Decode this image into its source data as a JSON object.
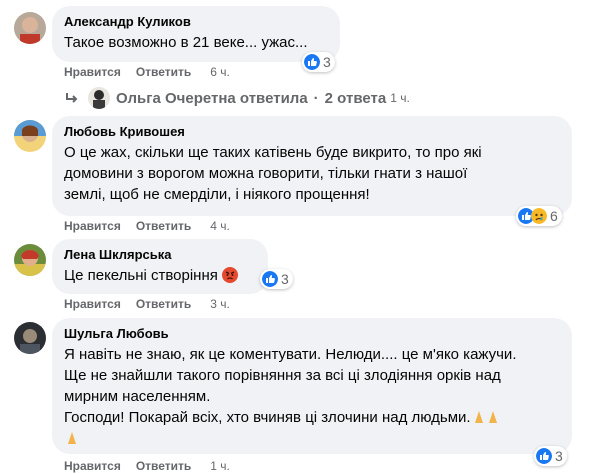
{
  "comments": [
    {
      "author": "Александр Куликов",
      "text_lines": [
        "Такое возможно в 21 веке... ужас..."
      ],
      "like": "Нравится",
      "reply": "Ответить",
      "time": "6 ч.",
      "reaction_count": "3",
      "reactions": [
        "like-icon"
      ]
    },
    {
      "author": "Любовь Кривошея",
      "text_lines": [
        "О це жах, скільки ще таких катівень буде викрито, то про які",
        "домовини з ворогом можна говорити, тільки гнати з нашої",
        "землі, щоб не смерділи, і ніякого прощення!"
      ],
      "like": "Нравится",
      "reply": "Ответить",
      "time": "4 ч.",
      "reaction_count": "6",
      "reactions": [
        "like-icon",
        "sad-icon"
      ]
    },
    {
      "author": "Лена Шклярська",
      "text_lines": [
        "Це пекельні створіння"
      ],
      "like": "Нравится",
      "reply": "Ответить",
      "time": "3 ч.",
      "reaction_count": "3",
      "reactions": [
        "like-icon"
      ],
      "emoji": "angry-face-icon"
    },
    {
      "author": "Шульга Любовь",
      "text_lines": [
        "Я навіть не знаю, як це коментувати. Нелюди.... це м'яко кажучи.",
        "Ще не знайшли такого порівняння за всі ці злодіяння орків над",
        "мирним населенням.",
        "Господи! Покарай всіх, хто вчиняв ці злочини над людьми."
      ],
      "like": "Нравится",
      "reply": "Ответить",
      "time": "1 ч.",
      "reaction_count": "3",
      "reactions": [
        "like-icon"
      ],
      "emoji": "praying-hands-icon"
    }
  ],
  "reply_thread": {
    "replier": "Ольга Очеретна ответила",
    "separator": "·",
    "count": "2 ответа",
    "time": "1 ч."
  },
  "colors": {
    "like_blue": "#1877f2",
    "bubble_bg": "#f0f2f5",
    "meta_gray": "#65676b",
    "sad_yellow": "#f7b928"
  }
}
